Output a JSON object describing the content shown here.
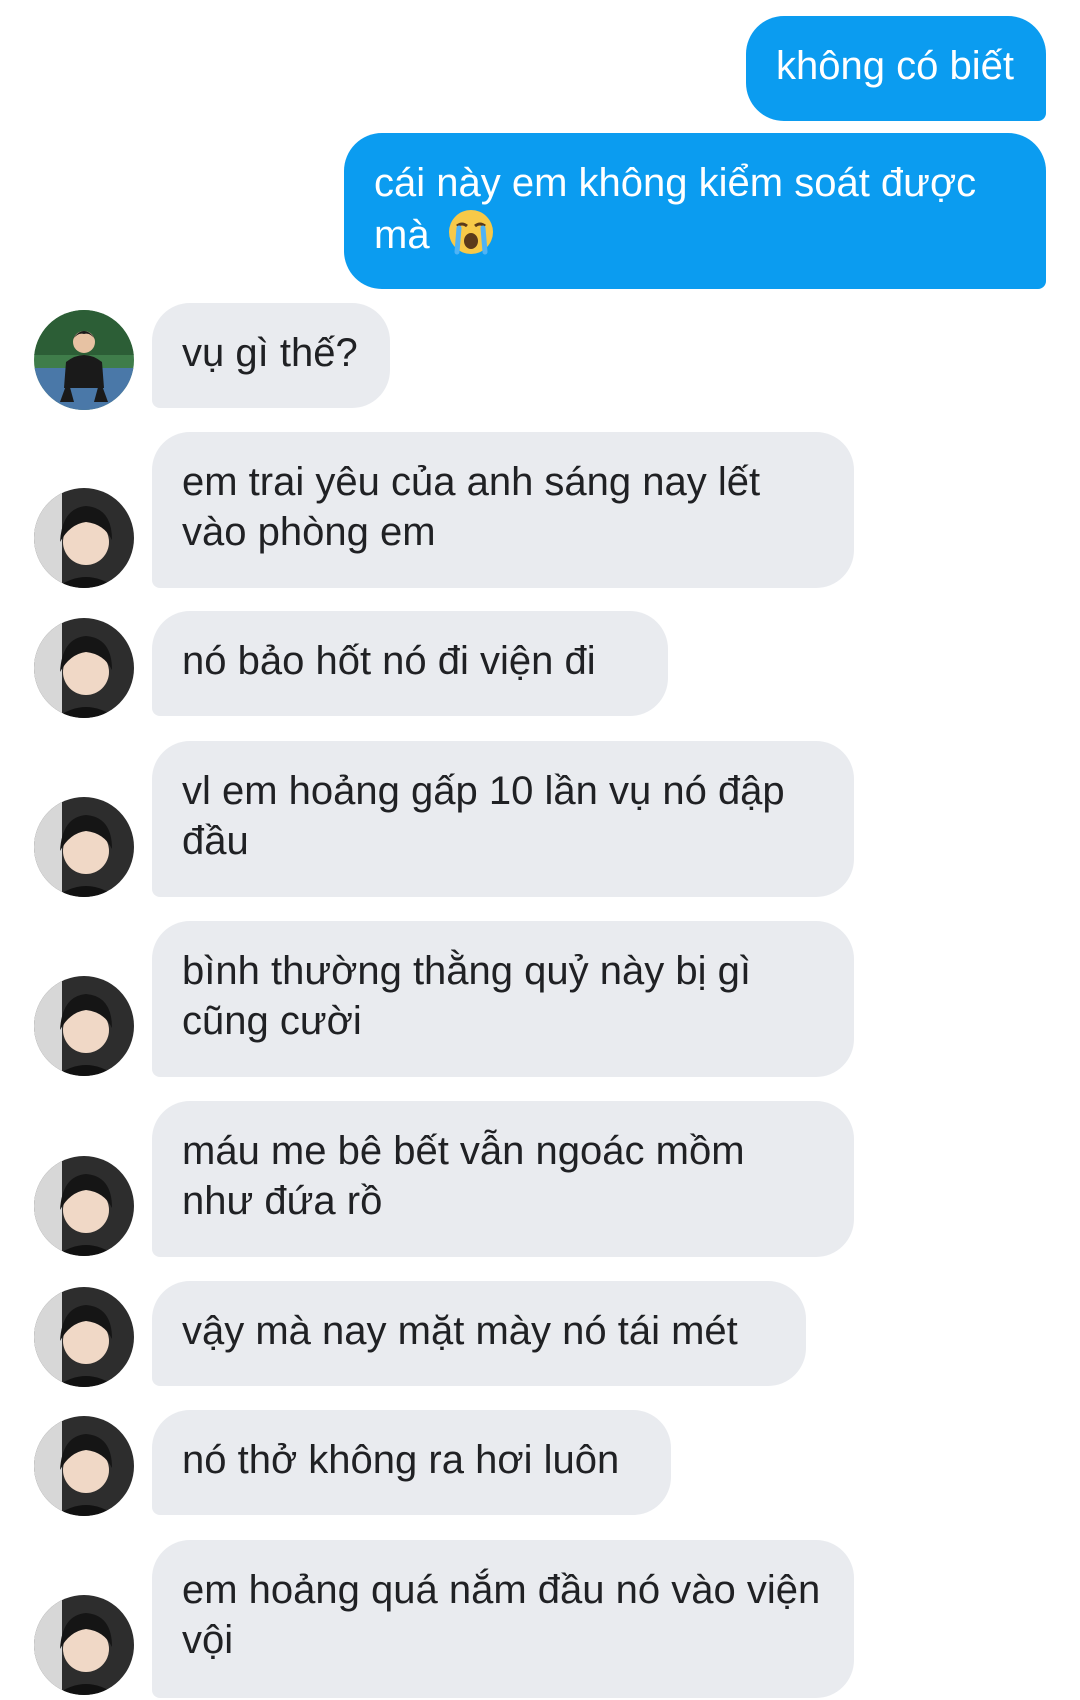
{
  "conversation": {
    "sent": [
      "không có biết",
      "cái này em không kiểm soát được mà"
    ],
    "received": [
      "vụ gì thế?",
      "em trai yêu của anh sáng nay lết vào phòng em",
      "nó bảo hốt nó đi viện đi",
      "vl em hoảng gấp 10 lần vụ nó đập đầu",
      "bình thường thằng quỷ này bị gì cũng cười",
      "máu me bê bết vẫn ngoác mồm như đứa rồ",
      "vậy mà nay mặt mày nó tái mét",
      "nó thở không ra hơi luôn",
      "em hoảng quá nắm đầu nó vào viện vội"
    ],
    "emoji": "loudly-crying-face",
    "colors": {
      "sent_bubble": "#0b9cf0",
      "received_bubble": "#e9ebef",
      "received_text": "#202124"
    }
  }
}
